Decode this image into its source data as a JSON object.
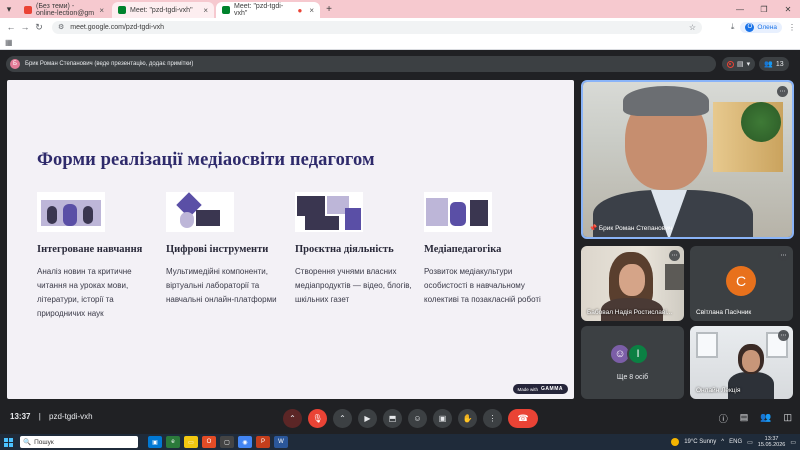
{
  "browser": {
    "tabs": [
      {
        "title": "(Без теми) - online-lection@gm",
        "favicon_color": "#ea4335"
      },
      {
        "title": "Meet: \"pzd-tgdi-vxh\"",
        "favicon_color": "#00832d"
      },
      {
        "title": "Meet: \"pzd-tgdi-vxh\"",
        "favicon_color": "#00832d"
      }
    ],
    "url": "meet.google.com/pzd-tgdi-vxh",
    "profile_label": "Оленa",
    "profile_initial": "О"
  },
  "meet": {
    "presenter_text": "Брик Роман Степанович (веде презентацію, додає примітки)",
    "presenter_initial": "Б",
    "participant_count": "13",
    "slide": {
      "title": "Форми реалізації медіаосвіти педагогом",
      "columns": [
        {
          "heading": "Інтегроване навчання",
          "body": "Аналіз новин та критичне читання на уроках мови, літератури, історії та природничих наук"
        },
        {
          "heading": "Цифрові інструменти",
          "body": "Мультимедійні компоненти, віртуальні лабораторії та навчальні онлайн-платформи"
        },
        {
          "heading": "Проєктна діяльність",
          "body": "Створення учнями власних медіапродуктів — відео, блогів, шкільних газет"
        },
        {
          "heading": "Медіапедагогіка",
          "body": "Розвиток медіакультури особистості в навчальному колективі та позакласній роботі"
        }
      ],
      "made_with": "Made with",
      "made_with_brand": "GAMMA"
    },
    "tiles": {
      "speaker_name": "Брик Роман Степанович",
      "woman_name": "Бабовал Надія Ростиславі...",
      "c_name": "Світлана Пасічник",
      "c_initial": "С",
      "more_label": "Ще 8 осіб",
      "lesson_name": "Онлайн Лекція"
    },
    "controls": {
      "time": "13:37",
      "meeting_code": "pzd-tgdi-vxh"
    }
  },
  "taskbar": {
    "search_placeholder": "Пошук",
    "weather": "19°C  Sunny",
    "lang": "ENG",
    "time": "13:37",
    "date": "15.05.2026"
  },
  "colors": {
    "accent": "#8ab4f8",
    "end_call": "#ea4335",
    "slide_title": "#2e2a6b",
    "avatar_c": "#e8711c"
  }
}
